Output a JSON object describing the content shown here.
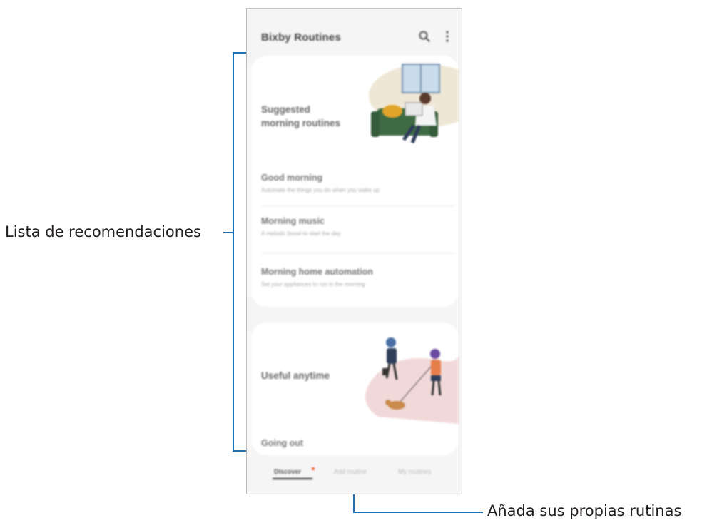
{
  "annotations": {
    "list_label": "Lista de recomendaciones",
    "add_label": "Añada sus propias rutinas"
  },
  "app": {
    "title": "Bixby Routines",
    "icons": [
      "search-icon",
      "more-options-icon"
    ]
  },
  "card1": {
    "heading_line1": "Suggested",
    "heading_line2": "morning routines",
    "items": [
      {
        "title": "Good morning",
        "desc": "Automate the things you do when you wake up"
      },
      {
        "title": "Morning music",
        "desc": "A melodic boost to start the day"
      },
      {
        "title": "Morning home automation",
        "desc": "Set your appliances to run in the morning"
      }
    ]
  },
  "card2": {
    "heading": "Useful anytime",
    "first_item": "Going out"
  },
  "tabs": [
    {
      "label": "Discover"
    },
    {
      "label": "Add routine"
    },
    {
      "label": "My routines"
    }
  ],
  "colors": {
    "accent_line": "#1f6fb5",
    "notification_dot": "#f05a28",
    "illustration_sofa": "#3e6b44",
    "illustration_bg1": "#efe7d6",
    "illustration_bg2": "#f2d9d9"
  }
}
